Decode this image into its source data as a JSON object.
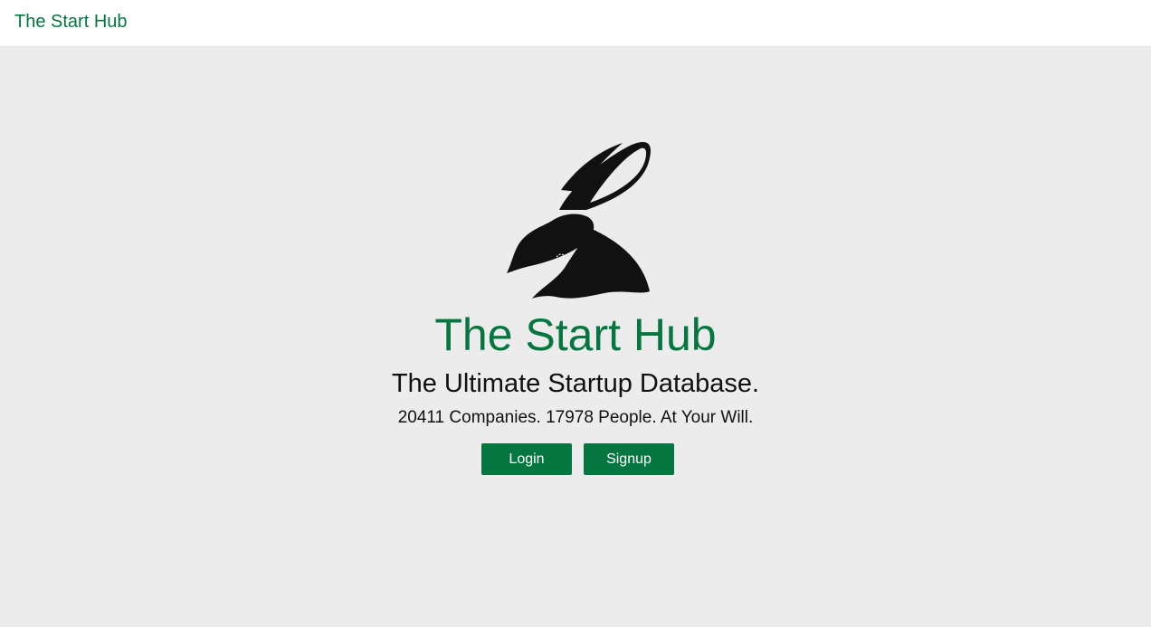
{
  "navbar": {
    "brand": "The Start Hub"
  },
  "hero": {
    "logo_icon": "rabbit-logo-icon",
    "title": "The Start Hub",
    "subtitle": "The Ultimate Startup Database.",
    "stats": "20411 Companies. 17978 People. At Your Will."
  },
  "actions": {
    "login_label": "Login",
    "signup_label": "Signup"
  },
  "colors": {
    "brand_green": "#057640",
    "background": "#ececec",
    "navbar_bg": "#ffffff",
    "text_dark": "#111111"
  }
}
